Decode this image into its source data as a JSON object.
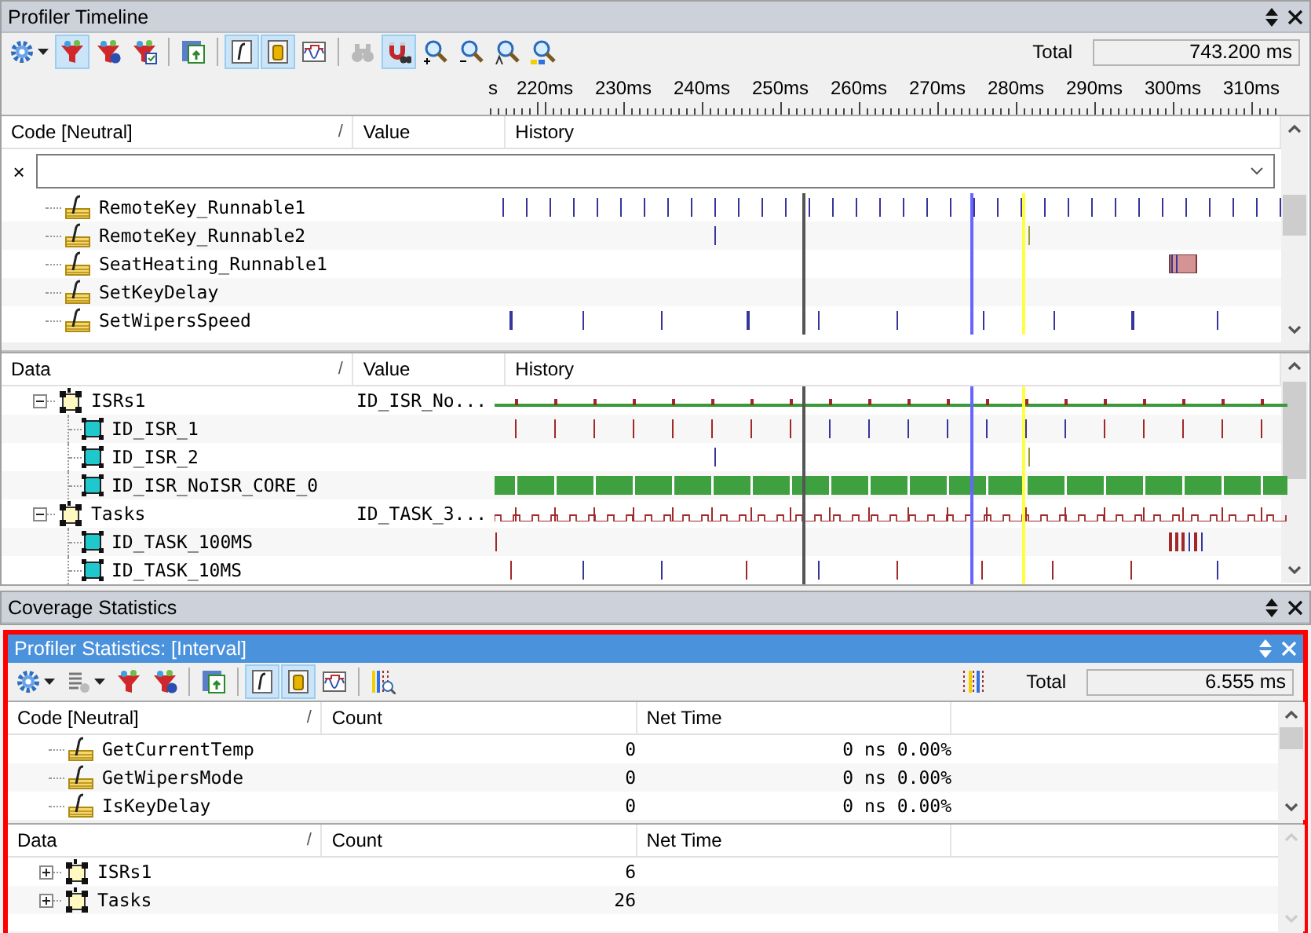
{
  "timeline": {
    "title": "Profiler Timeline",
    "toolbar": [
      {
        "kind": "settings",
        "menu": true,
        "selected": false,
        "disabled": false
      },
      {
        "kind": "filter",
        "menu": false,
        "selected": true,
        "disabled": false
      },
      {
        "kind": "filter_b",
        "menu": false,
        "selected": false,
        "disabled": false
      },
      {
        "kind": "filter_check",
        "menu": false,
        "selected": false,
        "disabled": false
      },
      {
        "kind": "separator"
      },
      {
        "kind": "export",
        "menu": false,
        "selected": false,
        "disabled": false
      },
      {
        "kind": "separator"
      },
      {
        "kind": "function",
        "menu": false,
        "selected": true,
        "disabled": false
      },
      {
        "kind": "database",
        "menu": false,
        "selected": true,
        "disabled": false
      },
      {
        "kind": "wave",
        "menu": false,
        "selected": false,
        "disabled": false
      },
      {
        "kind": "separator"
      },
      {
        "kind": "binoculars",
        "menu": false,
        "selected": false,
        "disabled": true
      },
      {
        "kind": "magnet",
        "menu": false,
        "selected": true,
        "disabled": false
      },
      {
        "kind": "zoom_in",
        "menu": false,
        "selected": false,
        "disabled": false
      },
      {
        "kind": "zoom_out",
        "menu": false,
        "selected": false,
        "disabled": false
      },
      {
        "kind": "zoom_a",
        "menu": false,
        "selected": false,
        "disabled": false
      },
      {
        "kind": "zoom_fit",
        "menu": false,
        "selected": false,
        "disabled": false
      }
    ],
    "total_label": "Total",
    "total_value": "743.200 ms",
    "ruler": [
      "s",
      "220ms",
      "230ms",
      "240ms",
      "250ms",
      "260ms",
      "270ms",
      "280ms",
      "290ms",
      "300ms",
      "310ms"
    ],
    "code_table": {
      "columns": [
        "Code [Neutral]",
        "Value",
        "History"
      ],
      "sort_mark": "/",
      "filter_clear": "×",
      "rows": [
        {
          "name": "RemoteKey_Runnable1"
        },
        {
          "name": "RemoteKey_Runnable2"
        },
        {
          "name": "SeatHeating_Runnable1"
        },
        {
          "name": "SetKeyDelay"
        },
        {
          "name": "SetWipersSpeed"
        }
      ]
    },
    "data_table": {
      "columns": [
        "Data",
        "Value",
        "History"
      ],
      "sort_mark": "/",
      "rows": [
        {
          "name": "ISRs1",
          "value": "ID_ISR_No...",
          "expanded": true,
          "children": [
            {
              "name": "ID_ISR_1"
            },
            {
              "name": "ID_ISR_2"
            },
            {
              "name": "ID_ISR_NoISR_CORE_0"
            }
          ]
        },
        {
          "name": "Tasks",
          "value": "ID_TASK_3...",
          "expanded": true,
          "children": [
            {
              "name": "ID_TASK_100MS"
            },
            {
              "name": "ID_TASK_10MS"
            }
          ]
        }
      ]
    }
  },
  "coverage": {
    "title": "Coverage Statistics"
  },
  "statistics": {
    "title": "Profiler Statistics: [Interval]",
    "toolbar": [
      {
        "kind": "settings",
        "menu": true,
        "selected": false,
        "disabled": false
      },
      {
        "kind": "columns",
        "menu": true,
        "selected": false,
        "disabled": false
      },
      {
        "kind": "filter",
        "menu": false,
        "selected": false,
        "disabled": false
      },
      {
        "kind": "filter_b",
        "menu": false,
        "selected": false,
        "disabled": false
      },
      {
        "kind": "separator"
      },
      {
        "kind": "export",
        "menu": false,
        "selected": false,
        "disabled": false
      },
      {
        "kind": "separator"
      },
      {
        "kind": "function",
        "menu": false,
        "selected": true,
        "disabled": false
      },
      {
        "kind": "database",
        "menu": false,
        "selected": true,
        "disabled": false
      },
      {
        "kind": "wave",
        "menu": false,
        "selected": false,
        "disabled": false
      },
      {
        "kind": "separator"
      },
      {
        "kind": "marker_search",
        "menu": false,
        "selected": false,
        "disabled": false
      }
    ],
    "toolbar_right": [
      {
        "kind": "markers",
        "menu": false,
        "selected": false,
        "disabled": false
      }
    ],
    "total_label": "Total",
    "total_value": "6.555 ms",
    "code_table": {
      "columns": [
        "Code [Neutral]",
        "Count",
        "Net Time"
      ],
      "sort_mark": "/",
      "rows": [
        {
          "name": "GetCurrentTemp",
          "count": "0",
          "net_time": "0 ns",
          "share": "0.00%"
        },
        {
          "name": "GetWipersMode",
          "count": "0",
          "net_time": "0 ns",
          "share": "0.00%"
        },
        {
          "name": "IsKeyDelay",
          "count": "0",
          "net_time": "0 ns",
          "share": "0.00%"
        }
      ]
    },
    "data_table": {
      "columns": [
        "Data",
        "Count",
        "Net Time"
      ],
      "sort_mark": "/",
      "rows": [
        {
          "name": "ISRs1",
          "count": "6",
          "expanded": false
        },
        {
          "name": "Tasks",
          "count": "26",
          "expanded": false
        }
      ]
    }
  }
}
